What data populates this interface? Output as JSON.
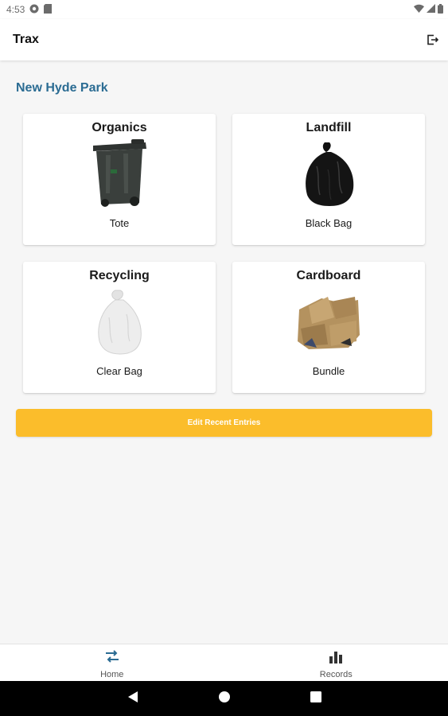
{
  "status_bar": {
    "time": "4:53"
  },
  "app_bar": {
    "title": "Trax"
  },
  "location": "New Hyde Park",
  "cards": [
    {
      "category": "Organics",
      "type": "Tote",
      "icon": "green-bin-image"
    },
    {
      "category": "Landfill",
      "type": "Black Bag",
      "icon": "black-bag-image"
    },
    {
      "category": "Recycling",
      "type": "Clear Bag",
      "icon": "clear-bag-image"
    },
    {
      "category": "Cardboard",
      "type": "Bundle",
      "icon": "cardboard-image"
    }
  ],
  "edit_button": {
    "label": "Edit Recent Entries"
  },
  "bottom_nav": [
    {
      "label": "Home",
      "icon": "swap-arrows-icon"
    },
    {
      "label": "Records",
      "icon": "bar-chart-icon"
    }
  ],
  "colors": {
    "accent": "#fbbd2b",
    "location": "#2b6c93",
    "home_icon": "#2b6c93"
  }
}
